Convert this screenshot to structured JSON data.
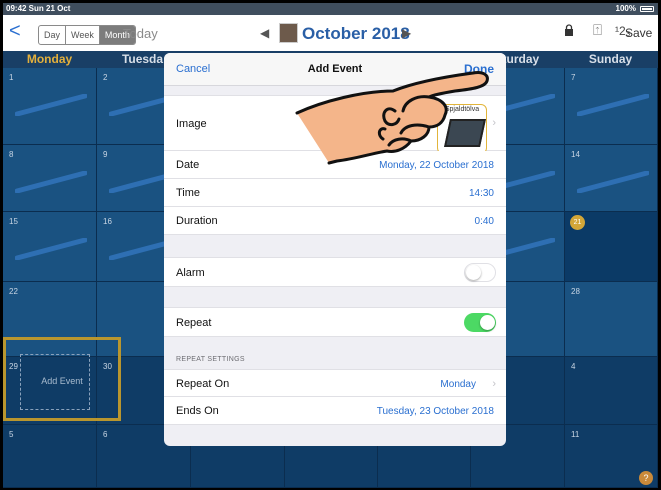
{
  "status_bar": {
    "time": "09:42  Sun 21 Oct",
    "battery": "100%"
  },
  "nav": {
    "back": "<",
    "views": [
      "Day",
      "Week",
      "Month"
    ],
    "active_view": "Month",
    "today": "Today",
    "prev": "◀",
    "month": "October 2018",
    "next": "▶",
    "number_toggle": "¹2₃",
    "save": "Save"
  },
  "weekdays": [
    "Monday",
    "Tuesday",
    "",
    "",
    "",
    "Saturday",
    "Sunday"
  ],
  "weekdays_visible": {
    "monday": "Monday",
    "tuesday": "Tuesda",
    "saturday": "aturday",
    "sunday": "Sunday"
  },
  "calendar": {
    "days": {
      "d1": "1",
      "d2": "2",
      "d7": "7",
      "d8": "8",
      "d9": "9",
      "d14": "14",
      "d15": "15",
      "d16": "16",
      "d21": "21",
      "d22": "22",
      "d28": "28",
      "d29": "29",
      "d30": "30",
      "d4": "4",
      "d5": "5",
      "d6": "6",
      "d11": "11"
    },
    "drop_label": "Add Event",
    "help": "?"
  },
  "modal": {
    "cancel": "Cancel",
    "title": "Add Event",
    "done": "Done",
    "image_label": "Image",
    "image_caption": "Spjaldtölva",
    "date_label": "Date",
    "date_value": "Monday, 22 October 2018",
    "time_label": "Time",
    "time_value": "14:30",
    "duration_label": "Duration",
    "duration_value": "0:40",
    "alarm_label": "Alarm",
    "alarm_on": false,
    "repeat_label": "Repeat",
    "repeat_on": true,
    "repeat_settings_header": "REPEAT SETTINGS",
    "repeat_on_label": "Repeat On",
    "repeat_on_value": "Monday",
    "ends_on_label": "Ends On",
    "ends_on_value": "Tuesday, 23 October 2018"
  },
  "colors": {
    "accent": "#2a6fd0",
    "today_badge": "#d3a638",
    "toggle_on": "#4cd964",
    "calendar_bg": "#1a5281"
  }
}
